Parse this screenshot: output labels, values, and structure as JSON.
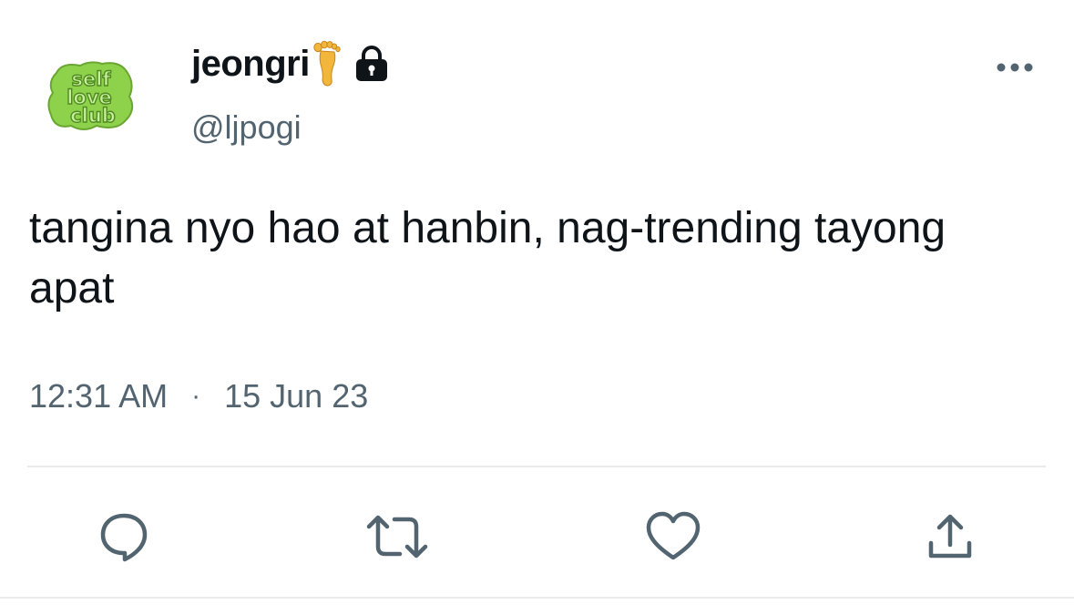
{
  "tweet": {
    "avatar": {
      "icon": "self-love-club-logo",
      "logo_text": "self love club",
      "color": "#8ed14b"
    },
    "author": {
      "display_name": "jeongri",
      "handle": "@ljpogi",
      "emoji_icon": "foot-icon",
      "protected_icon": "lock-icon"
    },
    "text": "tangina nyo hao at hanbin, nag-trending tayong apat",
    "time": "12:31 AM",
    "separator": "·",
    "date": "15 Jun 23",
    "more_icon": "more-dots-icon",
    "actions": [
      {
        "name": "reply",
        "icon": "reply-icon"
      },
      {
        "name": "retweet",
        "icon": "retweet-icon"
      },
      {
        "name": "like",
        "icon": "heart-icon"
      },
      {
        "name": "share",
        "icon": "share-icon"
      }
    ]
  },
  "colors": {
    "text_primary": "#0f1419",
    "text_secondary": "#536471",
    "divider": "#e7e9ea"
  }
}
